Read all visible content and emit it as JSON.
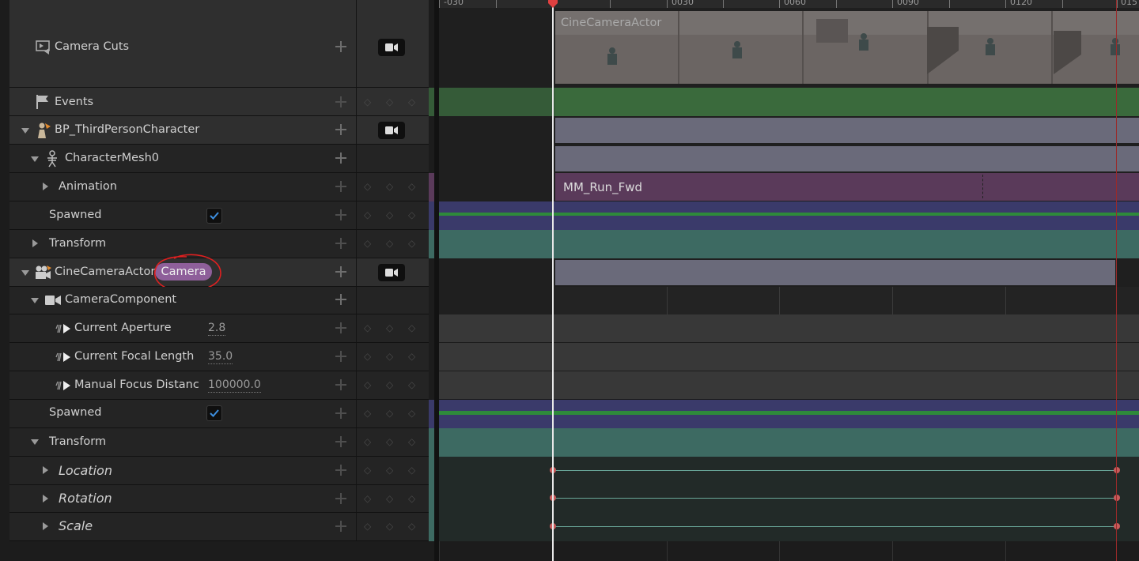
{
  "tracks": {
    "camera_cuts": "Camera Cuts",
    "events": "Events",
    "bp_character": "BP_ThirdPersonCharacter",
    "character_mesh": "CharacterMesh0",
    "animation": "Animation",
    "spawned_1": "Spawned",
    "transform_1": "Transform",
    "cine_camera": "CineCameraActor",
    "camera_badge": "Camera",
    "camera_component": "CameraComponent",
    "aperture": {
      "label": "Current Aperture",
      "value": "2.8"
    },
    "focal": {
      "label": "Current Focal Length",
      "value": "35.0"
    },
    "focus": {
      "label": "Manual Focus Distanc",
      "value": "100000.0"
    },
    "spawned_2": "Spawned",
    "transform_2": "Transform",
    "location": "Location",
    "rotation": "Rotation",
    "scale": "Scale"
  },
  "timeline": {
    "ruler_labels": [
      "-030",
      "0030",
      "0060",
      "0090",
      "0120",
      "015"
    ],
    "shot_label": "CineCameraActor",
    "anim_clip": "MM_Run_Fwd"
  },
  "colors": {
    "events_strip": "#355b38",
    "anim_strip": "#5a3a5a",
    "bool_strip": "#3a3a6a",
    "transform_strip": "#3d6a62",
    "playhead": "#e04040"
  }
}
